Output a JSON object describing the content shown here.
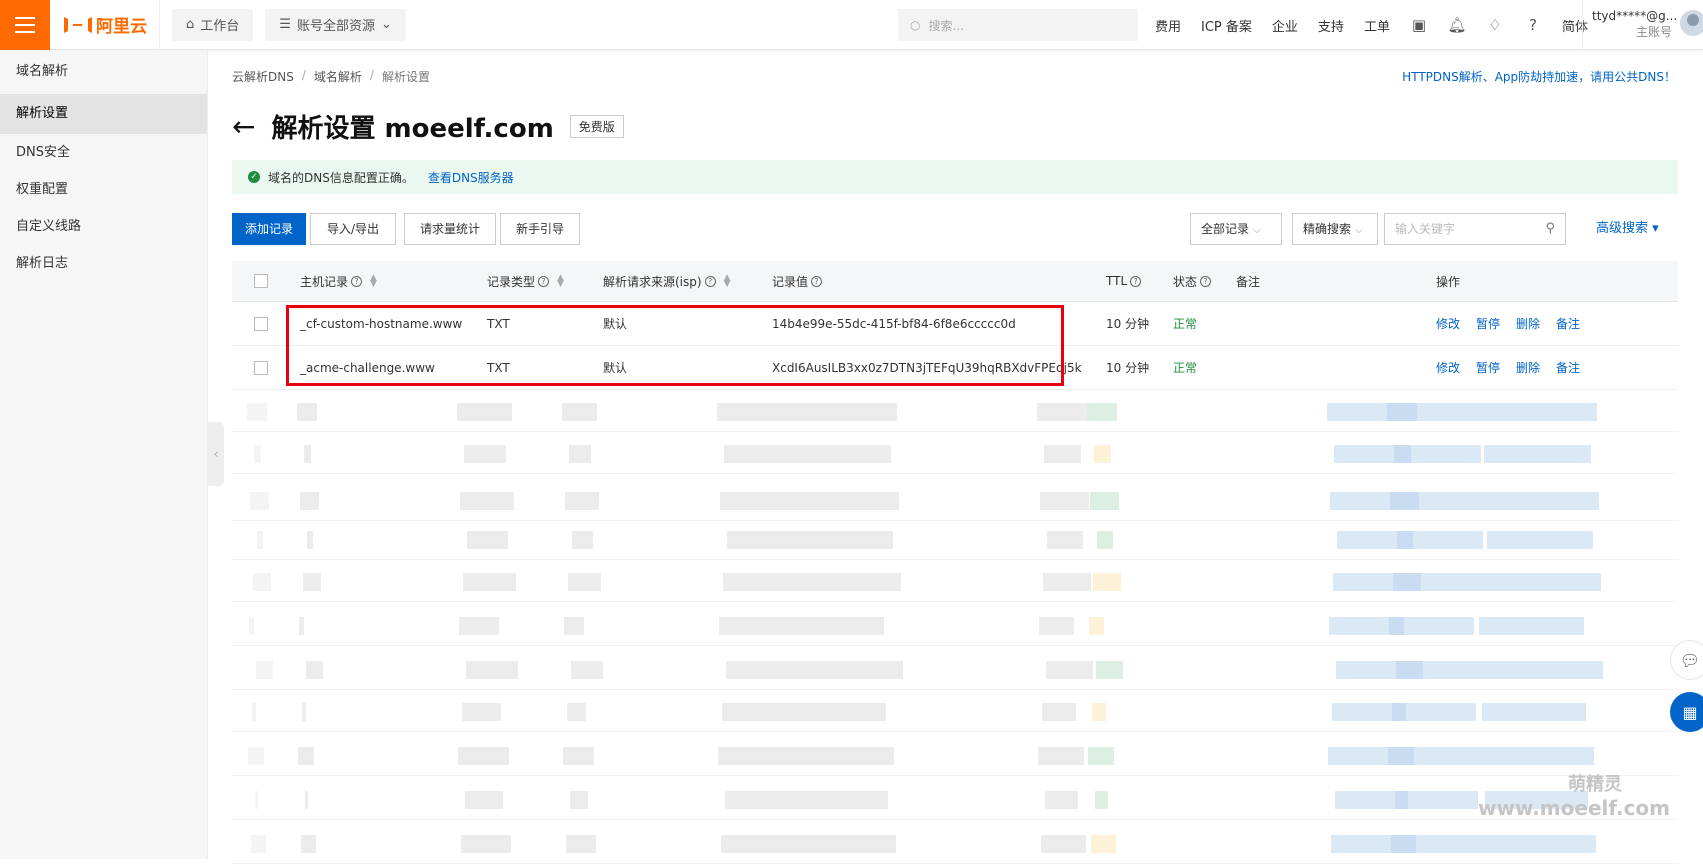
{
  "topbar": {
    "logo": "阿里云",
    "workbench": "工作台",
    "resources": "账号全部资源",
    "search_placeholder": "搜索...",
    "links": [
      "费用",
      "ICP 备案",
      "企业",
      "支持",
      "工单"
    ],
    "lang": "简体",
    "user_name": "ttyd*****@g...",
    "user_role": "主账号"
  },
  "sidebar": {
    "items": [
      {
        "label": "域名解析"
      },
      {
        "label": "解析设置"
      },
      {
        "label": "DNS安全"
      },
      {
        "label": "权重配置"
      },
      {
        "label": "自定义线路"
      },
      {
        "label": "解析日志"
      }
    ]
  },
  "breadcrumb": [
    "云解析DNS",
    "域名解析",
    "解析设置"
  ],
  "top_link": "HTTPDNS解析、App防劫持加速，请用公共DNS！",
  "title": "解析设置 moeelf.com",
  "badge": "免费版",
  "alert": {
    "text": "域名的DNS信息配置正确。",
    "link": "查看DNS服务器"
  },
  "toolbar": {
    "add": "添加记录",
    "import_export": "导入/导出",
    "stats": "请求量统计",
    "guide": "新手引导",
    "filter_all": "全部记录",
    "search_mode": "精确搜索",
    "keyword_placeholder": "输入关键字",
    "advanced": "高级搜索"
  },
  "table": {
    "headers": {
      "host": "主机记录",
      "type": "记录类型",
      "isp": "解析请求来源(isp)",
      "value": "记录值",
      "ttl": "TTL",
      "status": "状态",
      "remark": "备注",
      "ops": "操作"
    },
    "rows": [
      {
        "host": "_cf-custom-hostname.www",
        "type": "TXT",
        "isp": "默认",
        "value": "14b4e99e-55dc-415f-bf84-6f8e6ccccc0d",
        "ttl": "10 分钟",
        "status": "正常"
      },
      {
        "host": "_acme-challenge.www",
        "type": "TXT",
        "isp": "默认",
        "value": "XcdI6AusILB3xx0z7DTN3jTEFqU39hqRBXdvFPEdj5k",
        "ttl": "10 分钟",
        "status": "正常"
      }
    ],
    "ops": [
      "修改",
      "暂停",
      "删除",
      "备注"
    ]
  },
  "watermark": {
    "line1": "萌精灵",
    "line2": "www.moeelf.com"
  }
}
